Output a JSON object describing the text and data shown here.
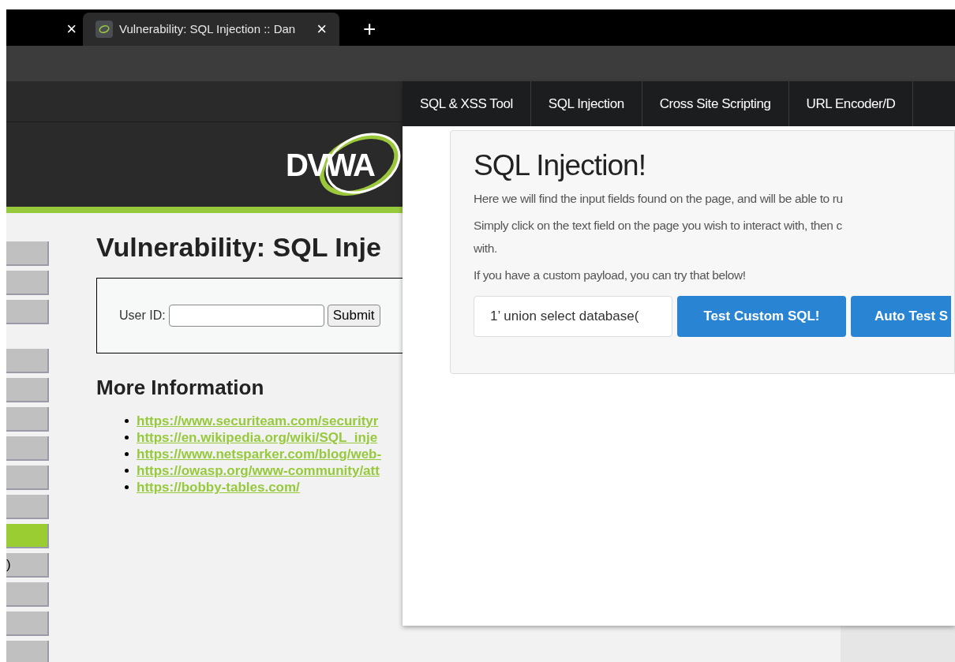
{
  "browser_tabs": [
    {
      "selected": false
    },
    {
      "title": "Vulnerability: SQL Injection :: Dan",
      "selected": true
    }
  ],
  "new_tab": "+",
  "close_glyph": "×",
  "site": {
    "logo": "DVWA",
    "sidebar": {
      "groups": [
        [
          {
            "selected": false
          },
          {
            "selected": false
          },
          {
            "selected": false
          }
        ],
        [
          {
            "selected": false
          },
          {
            "selected": false
          },
          {
            "selected": false
          },
          {
            "selected": false
          },
          {
            "selected": false
          },
          {
            "selected": false
          },
          {
            "selected": true
          },
          {
            "label": ")",
            "selected": false
          },
          {
            "selected": false
          },
          {
            "selected": false
          },
          {
            "selected": false
          }
        ]
      ]
    },
    "title": "Vulnerability: SQL Inje",
    "form": {
      "label": "User ID:",
      "button": "Submit"
    },
    "more_info": "More Information",
    "links": [
      "https://www.securiteam.com/securityr",
      "https://en.wikipedia.org/wiki/SQL_inje",
      "https://www.netsparker.com/blog/web-",
      "https://owasp.org/www-community/att",
      "https://bobby-tables.com/"
    ]
  },
  "extension": {
    "nav": [
      {
        "label": "SQL & XSS Tool",
        "selected": false
      },
      {
        "label": "SQL Injection",
        "selected": false
      },
      {
        "label": "Cross Site Scripting",
        "selected": false
      },
      {
        "label": "URL Encoder/D",
        "selected": false
      }
    ],
    "heading": "SQL Injection!",
    "paragraphs": [
      [
        "Here we will find the input fields found on the page, and will be able to ru"
      ],
      [
        "Simply click on the text field on the page you wish to interact with, then c",
        "with."
      ],
      [
        "If you have a custom payload, you can try that below!"
      ]
    ],
    "payload": "1’ union select database(",
    "buttons": [
      "Test Custom SQL!",
      "Auto Test S"
    ]
  }
}
